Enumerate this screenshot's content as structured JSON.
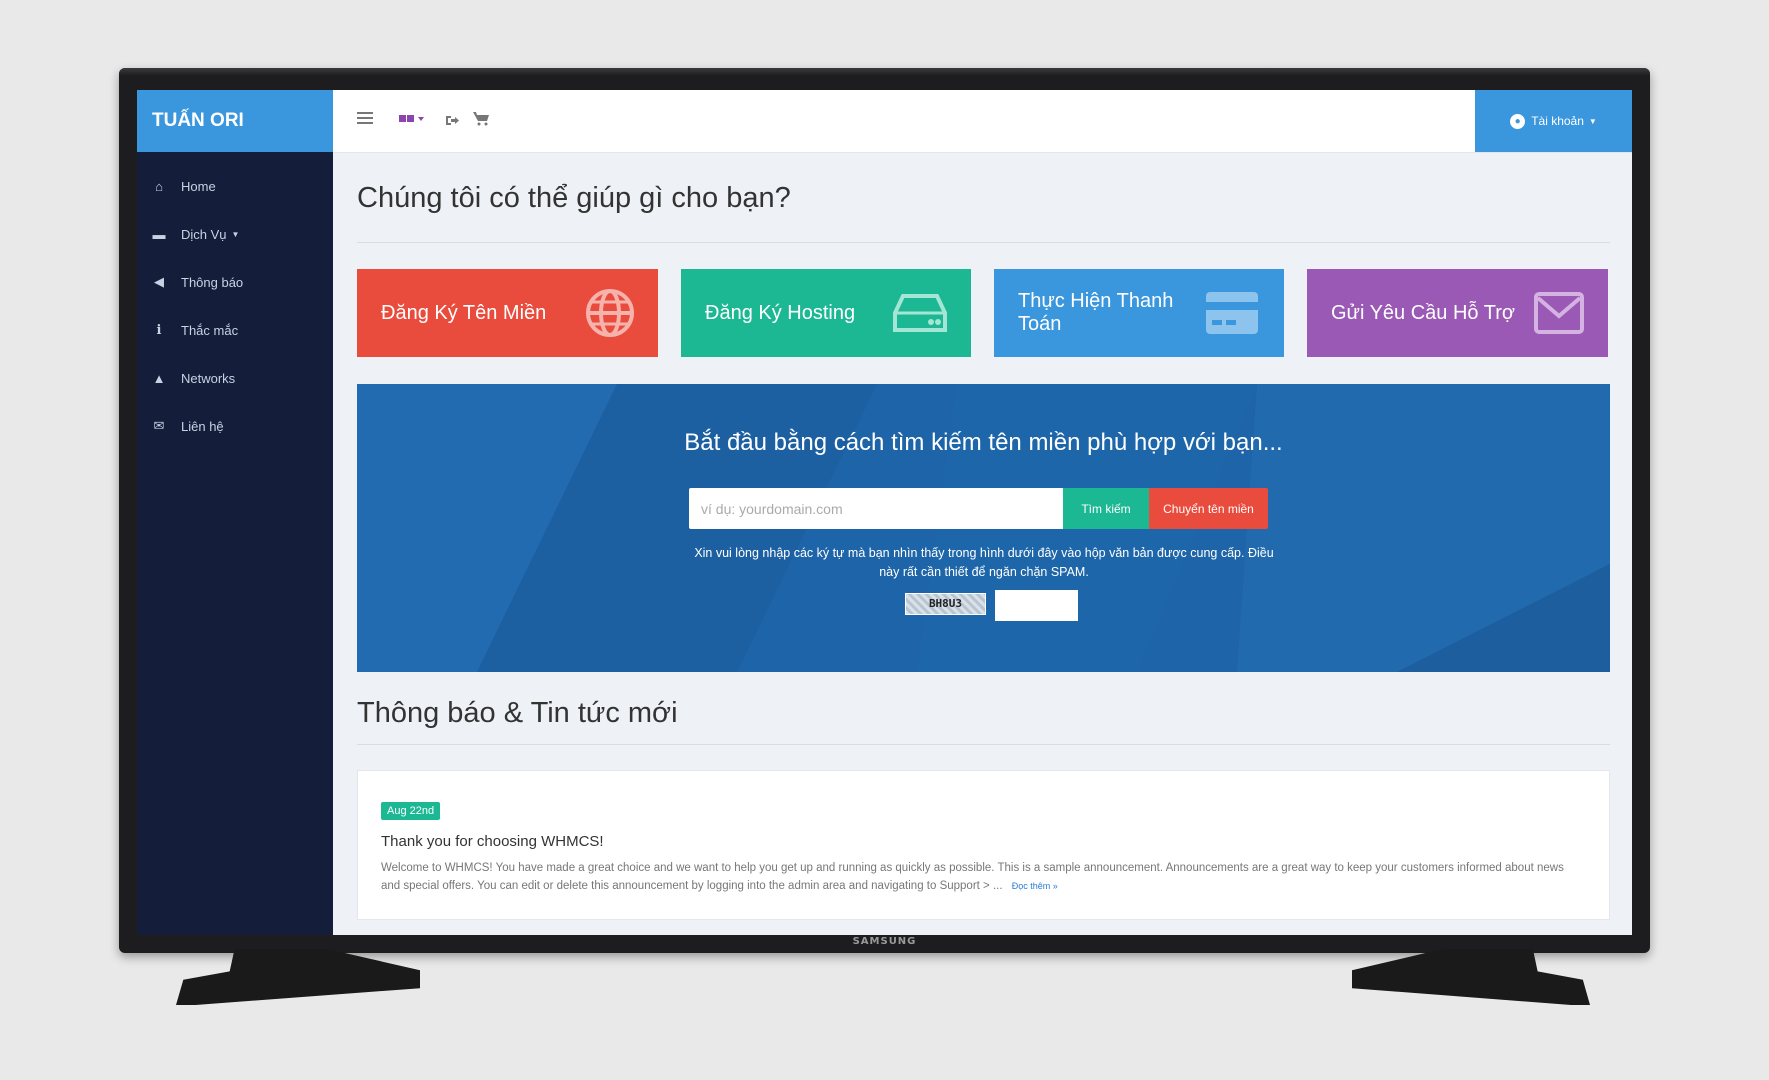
{
  "brand": "TUẤN ORI",
  "sidebar": {
    "items": [
      {
        "label": "Home",
        "icon": "home-icon",
        "glyph": "⌂"
      },
      {
        "label": "Dịch Vụ",
        "icon": "box-icon",
        "glyph": "▬",
        "has_caret": true
      },
      {
        "label": "Thông báo",
        "icon": "megaphone-icon",
        "glyph": "◀"
      },
      {
        "label": "Thắc mắc",
        "icon": "info-icon",
        "glyph": "i"
      },
      {
        "label": "Networks",
        "icon": "warning-icon",
        "glyph": "▲"
      },
      {
        "label": "Liên hệ",
        "icon": "envelope-icon",
        "glyph": "✉"
      }
    ]
  },
  "topbar": {
    "language_icon": "language-flag-icon",
    "account_label": "Tài khoản"
  },
  "main": {
    "title": "Chúng tôi có thể giúp gì cho bạn?",
    "tiles": [
      {
        "label": "Đăng Ký Tên Miền",
        "icon": "globe-icon",
        "color": "#e94b3c"
      },
      {
        "label": "Đăng Ký Hosting",
        "icon": "server-icon",
        "color": "#1bb893"
      },
      {
        "label": "Thực Hiện Thanh Toán",
        "icon": "credit-card-icon",
        "color": "#3a96dd"
      },
      {
        "label": "Gửi Yêu Cầu Hỗ Trợ",
        "icon": "envelope-icon",
        "color": "#9b59b6"
      }
    ],
    "domain_search": {
      "title": "Bắt đầu bằng cách tìm kiếm tên miền phù hợp với bạn...",
      "placeholder": "ví dụ: yourdomain.com",
      "search_button": "Tìm kiếm",
      "transfer_button": "Chuyển tên miền",
      "captcha_instructions": "Xin vui lòng nhập các ký tự mà bạn nhìn thấy trong hình dưới đây vào hộp văn bản được cung cấp. Điều này rất cần thiết để ngăn chặn SPAM.",
      "captcha_code": "BH8U3"
    },
    "news_title": "Thông báo & Tin tức mới",
    "announcement": {
      "date": "Aug 22nd",
      "title": "Thank you for choosing WHMCS!",
      "body": "Welcome to WHMCS! You have made a great choice and we want to help you get up and running as quickly as possible. This is a sample announcement. Announcements are a great way to keep your customers informed about news and special offers. You can edit or delete this announcement by logging into the admin area and navigating to Support > ...",
      "read_more": "Đọc thêm »"
    }
  },
  "tv_brand": "SAMSUNG",
  "colors": {
    "accent": "#3a96dd",
    "sidebar": "#141e3a",
    "green": "#1bb893",
    "red": "#e94b3c",
    "purple": "#9b59b6"
  }
}
